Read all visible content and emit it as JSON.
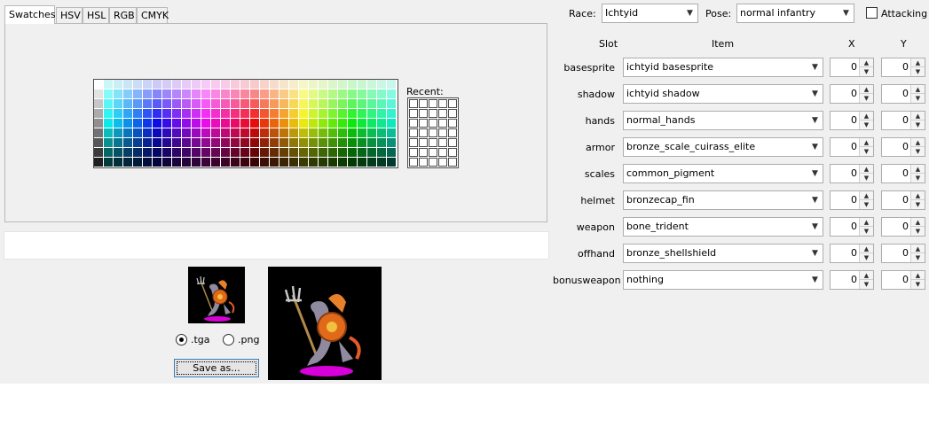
{
  "tabs": [
    {
      "label": "Swatches",
      "active": true
    },
    {
      "label": "HSV",
      "active": false
    },
    {
      "label": "HSL",
      "active": false
    },
    {
      "label": "RGB",
      "active": false
    },
    {
      "label": "CMYK",
      "active": false
    }
  ],
  "swatches": {
    "recent_label": "Recent:"
  },
  "export": {
    "format_tga": ".tga",
    "format_png": ".png",
    "selected": "tga",
    "save_label": "Save as..."
  },
  "header": {
    "race_label": "Race:",
    "race_value": "Ichtyid",
    "pose_label": "Pose:",
    "pose_value": "normal infantry",
    "attacking_label": "Attacking",
    "attacking_checked": false
  },
  "table": {
    "col_slot": "Slot",
    "col_item": "Item",
    "col_x": "X",
    "col_y": "Y",
    "rows": [
      {
        "slot": "basesprite",
        "item": "ichtyid basesprite",
        "x": "0",
        "y": "0"
      },
      {
        "slot": "shadow",
        "item": "ichtyid shadow",
        "x": "0",
        "y": "0"
      },
      {
        "slot": "hands",
        "item": "normal_hands",
        "x": "0",
        "y": "0"
      },
      {
        "slot": "armor",
        "item": "bronze_scale_cuirass_elite",
        "x": "0",
        "y": "0"
      },
      {
        "slot": "scales",
        "item": "common_pigment",
        "x": "0",
        "y": "0"
      },
      {
        "slot": "helmet",
        "item": "bronzecap_fin",
        "x": "0",
        "y": "0"
      },
      {
        "slot": "weapon",
        "item": "bone_trident",
        "x": "0",
        "y": "0"
      },
      {
        "slot": "offhand",
        "item": "bronze_shellshield",
        "x": "0",
        "y": "0"
      },
      {
        "slot": "bonusweapon",
        "item": "nothing",
        "x": "0",
        "y": "0"
      }
    ]
  },
  "icons": [
    "chevron-down-icon",
    "spin-up-icon",
    "spin-down-icon",
    "radio-icon",
    "checkbox-icon"
  ]
}
